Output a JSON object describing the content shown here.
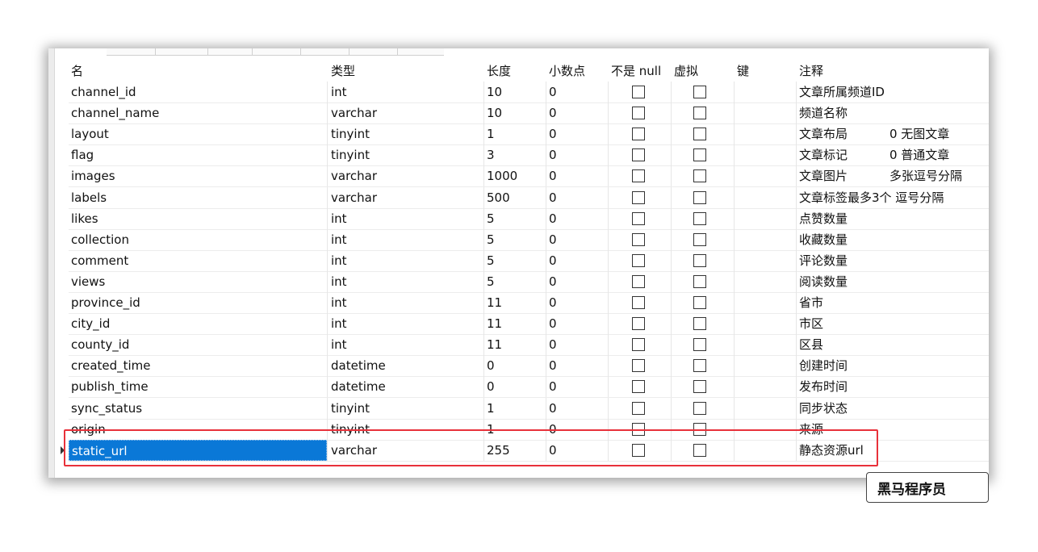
{
  "table_designer": {
    "columns": {
      "name": "名",
      "type": "类型",
      "length": "长度",
      "decimals": "小数点",
      "not_null": "不是 null",
      "virtual": "虚拟",
      "key": "键",
      "comment": "注释"
    },
    "rows": [
      {
        "name": "channel_id",
        "type": "int",
        "length": "10",
        "decimals": "0",
        "comment": "文章所属频道ID",
        "comment_extra": ""
      },
      {
        "name": "channel_name",
        "type": "varchar",
        "length": "10",
        "decimals": "0",
        "comment": "频道名称",
        "comment_extra": ""
      },
      {
        "name": "layout",
        "type": "tinyint",
        "length": "1",
        "decimals": "0",
        "comment": "文章布局",
        "comment_extra": "0 无图文章"
      },
      {
        "name": "flag",
        "type": "tinyint",
        "length": "3",
        "decimals": "0",
        "comment": "文章标记",
        "comment_extra": "0 普通文章"
      },
      {
        "name": "images",
        "type": "varchar",
        "length": "1000",
        "decimals": "0",
        "comment": "文章图片",
        "comment_extra": "多张逗号分隔"
      },
      {
        "name": "labels",
        "type": "varchar",
        "length": "500",
        "decimals": "0",
        "comment": "文章标签最多3个 逗号分隔",
        "comment_extra": ""
      },
      {
        "name": "likes",
        "type": "int",
        "length": "5",
        "decimals": "0",
        "comment": "点赞数量",
        "comment_extra": ""
      },
      {
        "name": "collection",
        "type": "int",
        "length": "5",
        "decimals": "0",
        "comment": "收藏数量",
        "comment_extra": ""
      },
      {
        "name": "comment",
        "type": "int",
        "length": "5",
        "decimals": "0",
        "comment": "评论数量",
        "comment_extra": ""
      },
      {
        "name": "views",
        "type": "int",
        "length": "5",
        "decimals": "0",
        "comment": "阅读数量",
        "comment_extra": ""
      },
      {
        "name": "province_id",
        "type": "int",
        "length": "11",
        "decimals": "0",
        "comment": "省市",
        "comment_extra": ""
      },
      {
        "name": "city_id",
        "type": "int",
        "length": "11",
        "decimals": "0",
        "comment": "市区",
        "comment_extra": ""
      },
      {
        "name": "county_id",
        "type": "int",
        "length": "11",
        "decimals": "0",
        "comment": "区县",
        "comment_extra": ""
      },
      {
        "name": "created_time",
        "type": "datetime",
        "length": "0",
        "decimals": "0",
        "comment": "创建时间",
        "comment_extra": ""
      },
      {
        "name": "publish_time",
        "type": "datetime",
        "length": "0",
        "decimals": "0",
        "comment": "发布时间",
        "comment_extra": ""
      },
      {
        "name": "sync_status",
        "type": "tinyint",
        "length": "1",
        "decimals": "0",
        "comment": "同步状态",
        "comment_extra": ""
      },
      {
        "name": "origin",
        "type": "tinyint",
        "length": "1",
        "decimals": "0",
        "comment": "来源",
        "comment_extra": ""
      },
      {
        "name": "static_url",
        "type": "varchar",
        "length": "255",
        "decimals": "0",
        "comment": "静态资源url",
        "comment_extra": "",
        "selected": true
      }
    ]
  },
  "watermark": "黑马程序员",
  "colors": {
    "selection": "#0a78d7",
    "highlight_box": "#e8313a"
  }
}
